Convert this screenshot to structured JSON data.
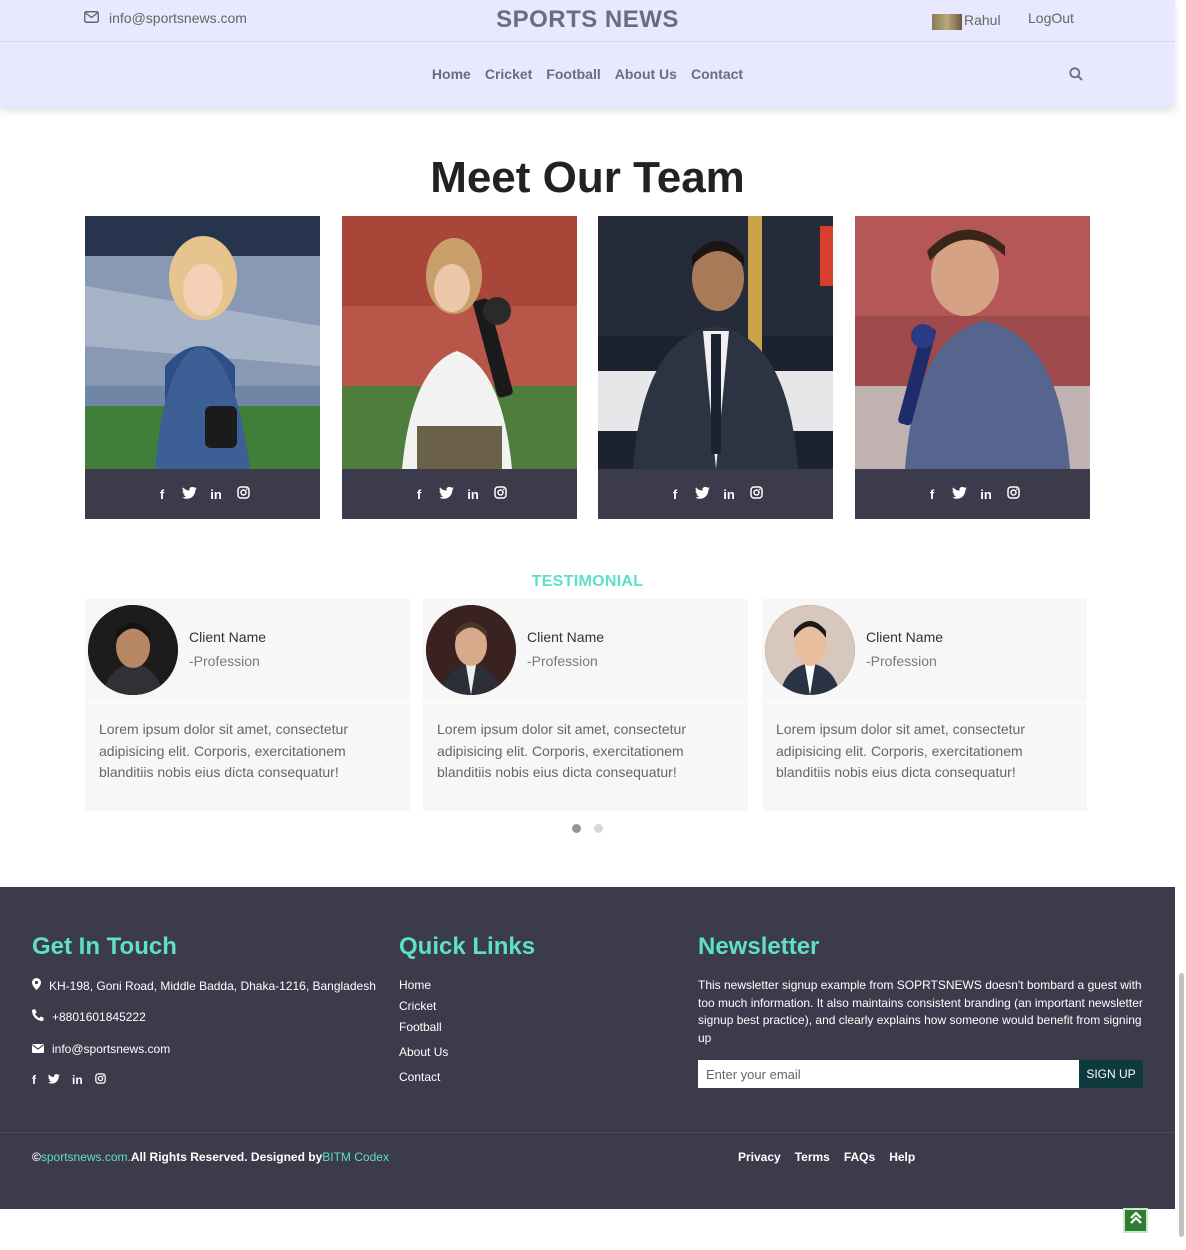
{
  "header": {
    "email": "info@sportsnews.com",
    "brand": "SPORTS NEWS",
    "user_name": "Rahul",
    "logout_label": "LogOut",
    "nav": [
      "Home",
      "Cricket",
      "Football",
      "About Us",
      "Contact"
    ]
  },
  "team": {
    "title": "Meet Our Team",
    "members": [
      {
        "social": [
          "f",
          "t",
          "in",
          "ig"
        ]
      },
      {
        "social": [
          "f",
          "t",
          "in",
          "ig"
        ]
      },
      {
        "social": [
          "f",
          "t",
          "in",
          "ig"
        ]
      },
      {
        "social": [
          "f",
          "t",
          "in",
          "ig"
        ]
      }
    ]
  },
  "testimonial": {
    "title": "TESTIMONIAL",
    "cards": [
      {
        "name": "Client Name",
        "profession": "-Profession",
        "text": "Lorem ipsum dolor sit amet, consectetur adipisicing elit. Corporis, exercitationem blanditiis nobis eius dicta consequatur!"
      },
      {
        "name": "Client Name",
        "profession": "-Profession",
        "text": "Lorem ipsum dolor sit amet, consectetur adipisicing elit. Corporis, exercitationem blanditiis nobis eius dicta consequatur!"
      },
      {
        "name": "Client Name",
        "profession": "-Profession",
        "text": "Lorem ipsum dolor sit amet, consectetur adipisicing elit. Corporis, exercitationem blanditiis nobis eius dicta consequatur!"
      }
    ],
    "pages": 2,
    "active_page": 1
  },
  "footer": {
    "contact_title": "Get In Touch",
    "address": "KH-198, Goni Road, Middle Badda, Dhaka-1216, Bangladesh",
    "phone": "+8801601845222",
    "email": "info@sportsnews.com",
    "links_title": "Quick Links",
    "links": [
      "Home",
      "Cricket",
      "Football",
      "About Us",
      "Contact"
    ],
    "newsletter_title": "Newsletter",
    "newsletter_text": "This newsletter signup example from SOPRTSNEWS doesn't bombard a guest with too much information. It also maintains consistent branding (an important newsletter signup best practice), and clearly explains how someone would benefit from signing up",
    "email_placeholder": "Enter your email",
    "signup_label": "SIGN UP",
    "copyright_symbol": "©",
    "copyright_site": "sportsnews.com.",
    "copyright_text": "All Rights Reserved. Designed by",
    "designer": "BITM Codex",
    "bottom_links": [
      "Privacy",
      "Terms",
      "FAQs",
      "Help"
    ]
  },
  "colors": {
    "header_bg": "#e8e8ff",
    "accent": "#5de0c6",
    "footer_bg": "#3c3b4b",
    "signup_bg": "#0e3a3f"
  }
}
